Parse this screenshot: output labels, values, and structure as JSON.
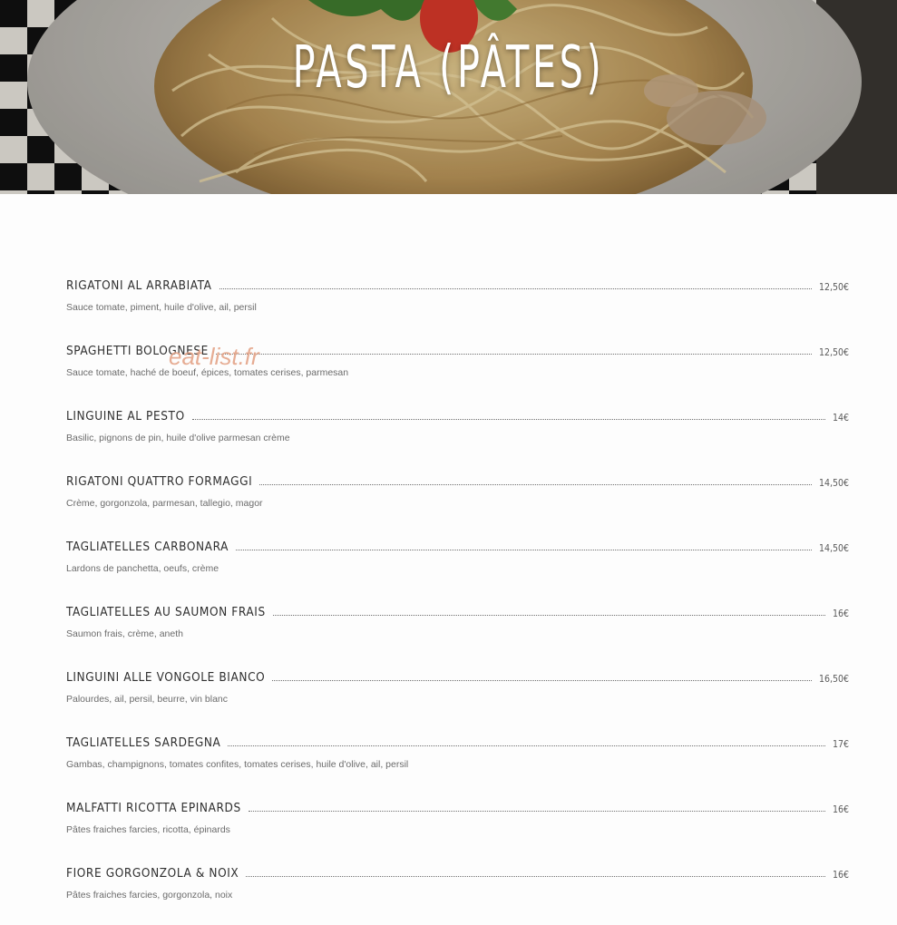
{
  "header": {
    "title": "PASTA (PÂTES)",
    "image": "spaghetti-plate-photo"
  },
  "watermark": "eat-list.fr",
  "colors": {
    "text_dark": "#2f2f2f",
    "text_muted": "#6b6b6b",
    "background": "#fdfdfd",
    "watermark": "#e4a488"
  },
  "menu": {
    "items": [
      {
        "name": "RIGATONI AL ARRABIATA",
        "price": "12,50€",
        "description": "Sauce tomate, piment, huile d'olive, ail, persil"
      },
      {
        "name": "SPAGHETTI BOLOGNESE",
        "price": "12,50€",
        "description": "Sauce tomate, haché de boeuf, épices, tomates cerises, parmesan"
      },
      {
        "name": "LINGUINE AL PESTO",
        "price": "14€",
        "description": "Basilic, pignons de pin, huile d'olive parmesan crème"
      },
      {
        "name": "RIGATONI QUATTRO FORMAGGI",
        "price": "14,50€",
        "description": "Crème, gorgonzola, parmesan, tallegio, magor"
      },
      {
        "name": "TAGLIATELLES CARBONARA",
        "price": "14,50€",
        "description": "Lardons de panchetta, oeufs, crème"
      },
      {
        "name": "TAGLIATELLES AU SAUMON FRAIS",
        "price": "16€",
        "description": "Saumon frais, crème, aneth"
      },
      {
        "name": "LINGUINI ALLE VONGOLE BIANCO",
        "price": "16,50€",
        "description": "Palourdes, ail, persil, beurre, vin blanc"
      },
      {
        "name": "TAGLIATELLES SARDEGNA",
        "price": "17€",
        "description": "Gambas, champignons, tomates confites, tomates cerises, huile d'olive, ail, persil"
      },
      {
        "name": "MALFATTI RICOTTA EPINARDS",
        "price": "16€",
        "description": "Pâtes fraiches farcies, ricotta, épinards"
      },
      {
        "name": "FIORE GORGONZOLA & NOIX",
        "price": "16€",
        "description": "Pâtes fraiches farcies, gorgonzola, noix"
      }
    ]
  }
}
